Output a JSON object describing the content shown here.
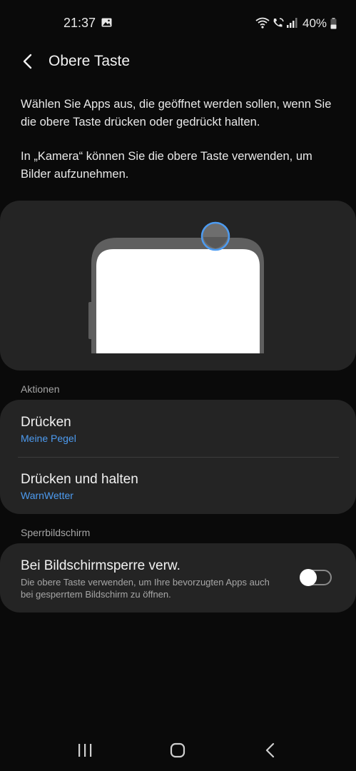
{
  "status_bar": {
    "time": "21:37",
    "battery": "40%",
    "icons": [
      "image-icon",
      "wifi-icon",
      "wifi-call-icon",
      "signal-icon",
      "battery-icon"
    ]
  },
  "header": {
    "title": "Obere Taste",
    "back_icon": "back-chevron-icon"
  },
  "description": {
    "paragraph_1": "Wählen Sie Apps aus, die geöffnet werden sollen, wenn Sie die obere Taste drücken oder gedrückt halten.",
    "paragraph_2": "In „Kamera“ können Sie die obere Taste verwenden, um Bilder aufzunehmen."
  },
  "illustration": {
    "highlight_color": "#4d9bf0"
  },
  "actions": {
    "section_label": "Aktionen",
    "items": [
      {
        "title": "Drücken",
        "value": "Meine Pegel"
      },
      {
        "title": "Drücken und halten",
        "value": "WarnWetter"
      }
    ]
  },
  "lock_screen": {
    "section_label": "Sperrbildschirm",
    "title": "Bei Bildschirmsperre verw.",
    "description": "Die obere Taste verwenden, um Ihre bevorzugten Apps auch bei gesperrtem Bildschirm zu öffnen.",
    "toggle_on": false
  },
  "nav_bar": {
    "icons": [
      "recents-icon",
      "home-icon",
      "back-icon"
    ]
  },
  "colors": {
    "background": "#0a0a0a",
    "card": "#242424",
    "accent": "#4d9bf0",
    "secondary_text": "#a6a6a6"
  }
}
